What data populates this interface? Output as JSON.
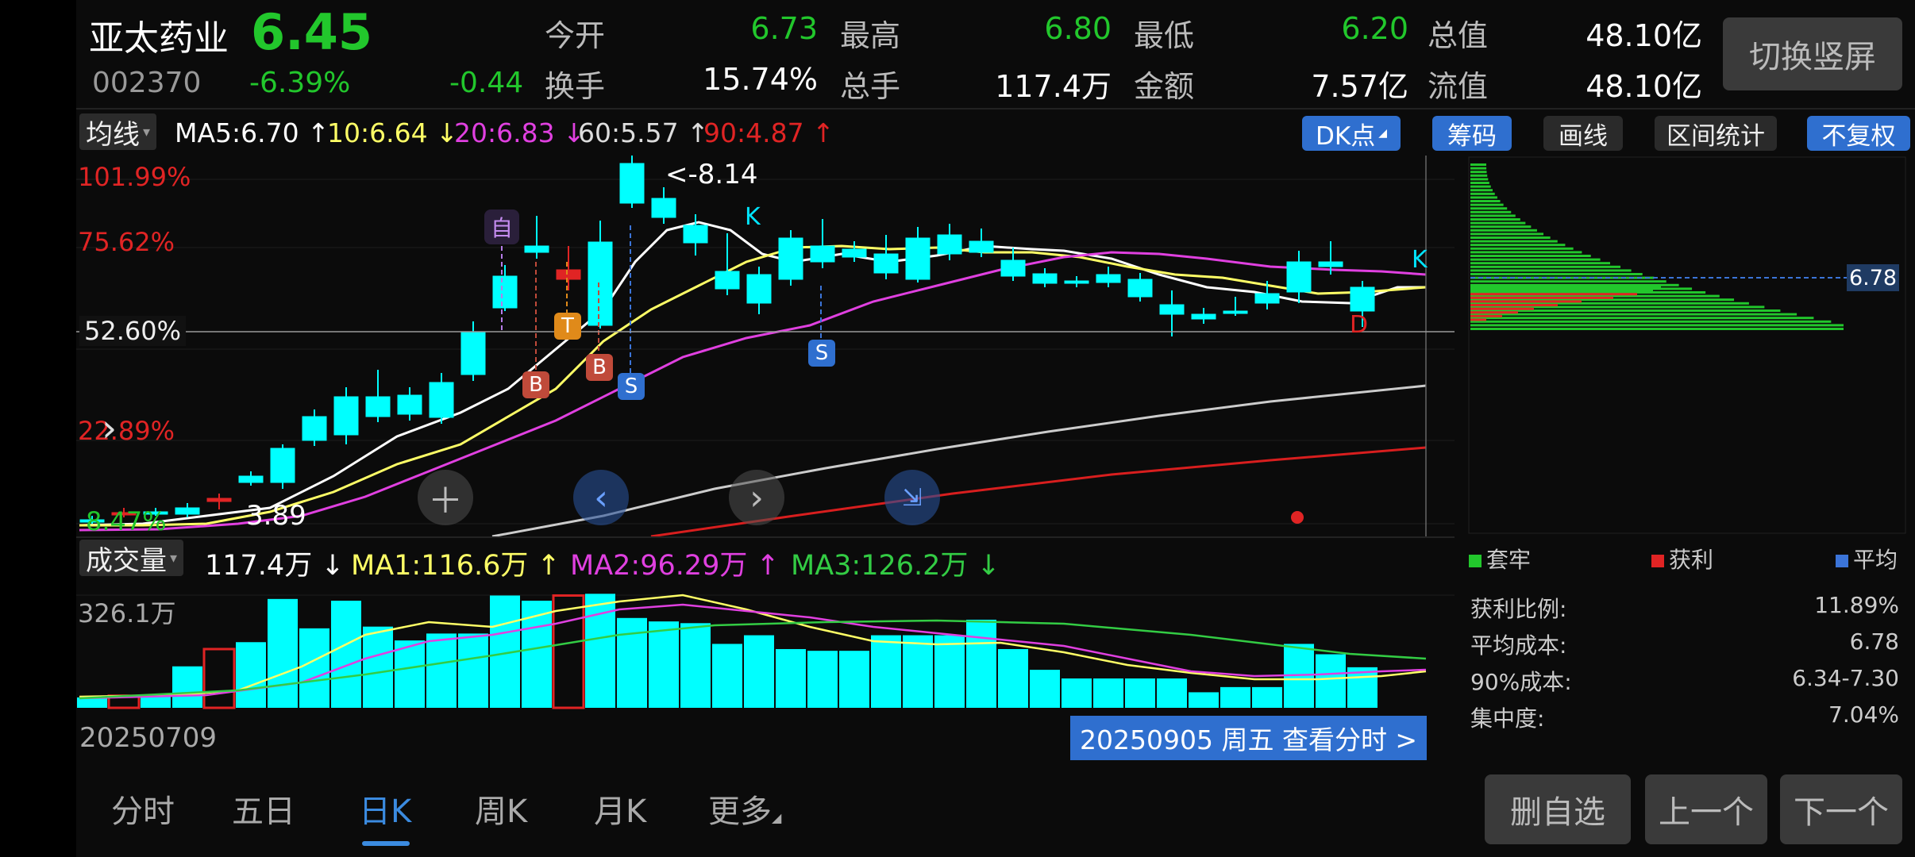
{
  "header": {
    "name": "亚太药业",
    "price": "6.45",
    "code": "002370",
    "change_pct": "-6.39%",
    "change": "-0.44",
    "stats": [
      {
        "label": "今开",
        "value": "6.73",
        "color": "green"
      },
      {
        "label": "最高",
        "value": "6.80",
        "color": "green"
      },
      {
        "label": "最低",
        "value": "6.20",
        "color": "green"
      },
      {
        "label": "总值",
        "value": "48.10亿",
        "color": "white"
      },
      {
        "label": "换手",
        "value": "15.74%",
        "color": "white"
      },
      {
        "label": "总手",
        "value": "117.4万",
        "color": "white"
      },
      {
        "label": "金额",
        "value": "7.57亿",
        "color": "white"
      },
      {
        "label": "流值",
        "value": "48.10亿",
        "color": "white"
      }
    ],
    "switch_button": "切换竖屏"
  },
  "ma_bar": {
    "selector": "均线",
    "ma5": "MA5:6.70",
    "ma10": "10:6.64",
    "ma20": "20:6.83",
    "ma60": "60:5.57",
    "ma90": "90:4.87",
    "tools": [
      "DK点",
      "筹码",
      "画线",
      "区间统计",
      "不复权"
    ]
  },
  "price_chart": {
    "ticks": [
      "101.99%",
      "75.62%",
      "52.60%",
      "22.89%",
      "8.47%"
    ],
    "labels": {
      "max_label": "<-8.14",
      "min_label": "3.89",
      "k1": "K",
      "k2": "K",
      "d": "D"
    },
    "markers": {
      "zi": "自",
      "t": "T",
      "b": "B",
      "s": "S"
    },
    "colors": {
      "up": "#e02424",
      "down": "#00ffff",
      "ma5": "#ffffff",
      "ma10": "#ffff66",
      "ma20": "#e040e0",
      "ma60": "#cccccc",
      "ma90": "#d81e1e"
    }
  },
  "volume_bar": {
    "selector": "成交量",
    "vol": "117.4万",
    "ma1": "MA1:116.6万",
    "ma2": "MA2:96.29万",
    "ma3": "MA3:126.2万",
    "max_tick": "326.1万"
  },
  "chart_data": {
    "type": "candlestick",
    "start_date": "20250709",
    "selected_date_label": "20250905 周五 查看分时 >",
    "series_names": [
      "MA5",
      "10",
      "20",
      "60",
      "90"
    ],
    "volume_max": 326.1,
    "volumes_wan": [
      30,
      35,
      35,
      120,
      170,
      190,
      315,
      230,
      310,
      235,
      195,
      215,
      215,
      325,
      310,
      325,
      330,
      260,
      250,
      245,
      185,
      210,
      170,
      165,
      165,
      210,
      210,
      210,
      255,
      170,
      110,
      85,
      85,
      85,
      85,
      45,
      60,
      60,
      185,
      155,
      117.4
    ]
  },
  "chip_panel": {
    "avg_label": "6.78",
    "legend": [
      "套牢",
      "获利",
      "平均"
    ],
    "rows": [
      {
        "label": "获利比例:",
        "value": "11.89%"
      },
      {
        "label": "平均成本:",
        "value": "6.78"
      },
      {
        "label": "90%成本:",
        "value": "6.34-7.30"
      },
      {
        "label": "集中度:",
        "value": "7.04%"
      }
    ]
  },
  "tabs": [
    "分时",
    "五日",
    "日K",
    "周K",
    "月K",
    "更多"
  ],
  "bottom_buttons": [
    "删自选",
    "上一个",
    "下一个"
  ]
}
